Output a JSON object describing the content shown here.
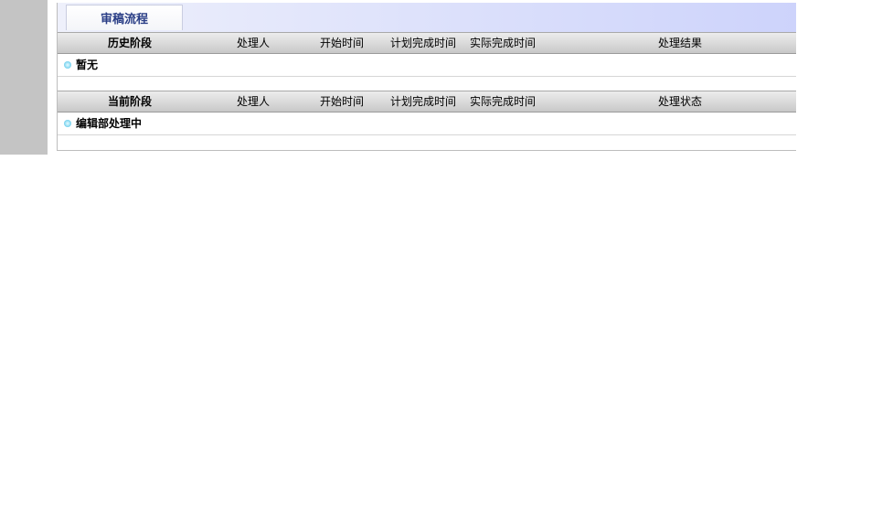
{
  "tab": {
    "label": "审稿流程"
  },
  "history": {
    "headers": {
      "stage": "历史阶段",
      "handler": "处理人",
      "start": "开始时间",
      "planned": "计划完成时间",
      "actual": "实际完成时间",
      "result": "处理结果"
    },
    "rows": [
      {
        "stage": "暂无"
      }
    ]
  },
  "current": {
    "headers": {
      "stage": "当前阶段",
      "handler": "处理人",
      "start": "开始时间",
      "planned": "计划完成时间",
      "actual": "实际完成时间",
      "status": "处理状态"
    },
    "rows": [
      {
        "stage": "编辑部处理中"
      }
    ]
  },
  "colors": {
    "tab_text": "#2a3e86",
    "left_strip": "#c4c4c4",
    "bullet": "#3cb6de"
  },
  "icons": {
    "row_bullet": "circle-bullet-icon"
  }
}
